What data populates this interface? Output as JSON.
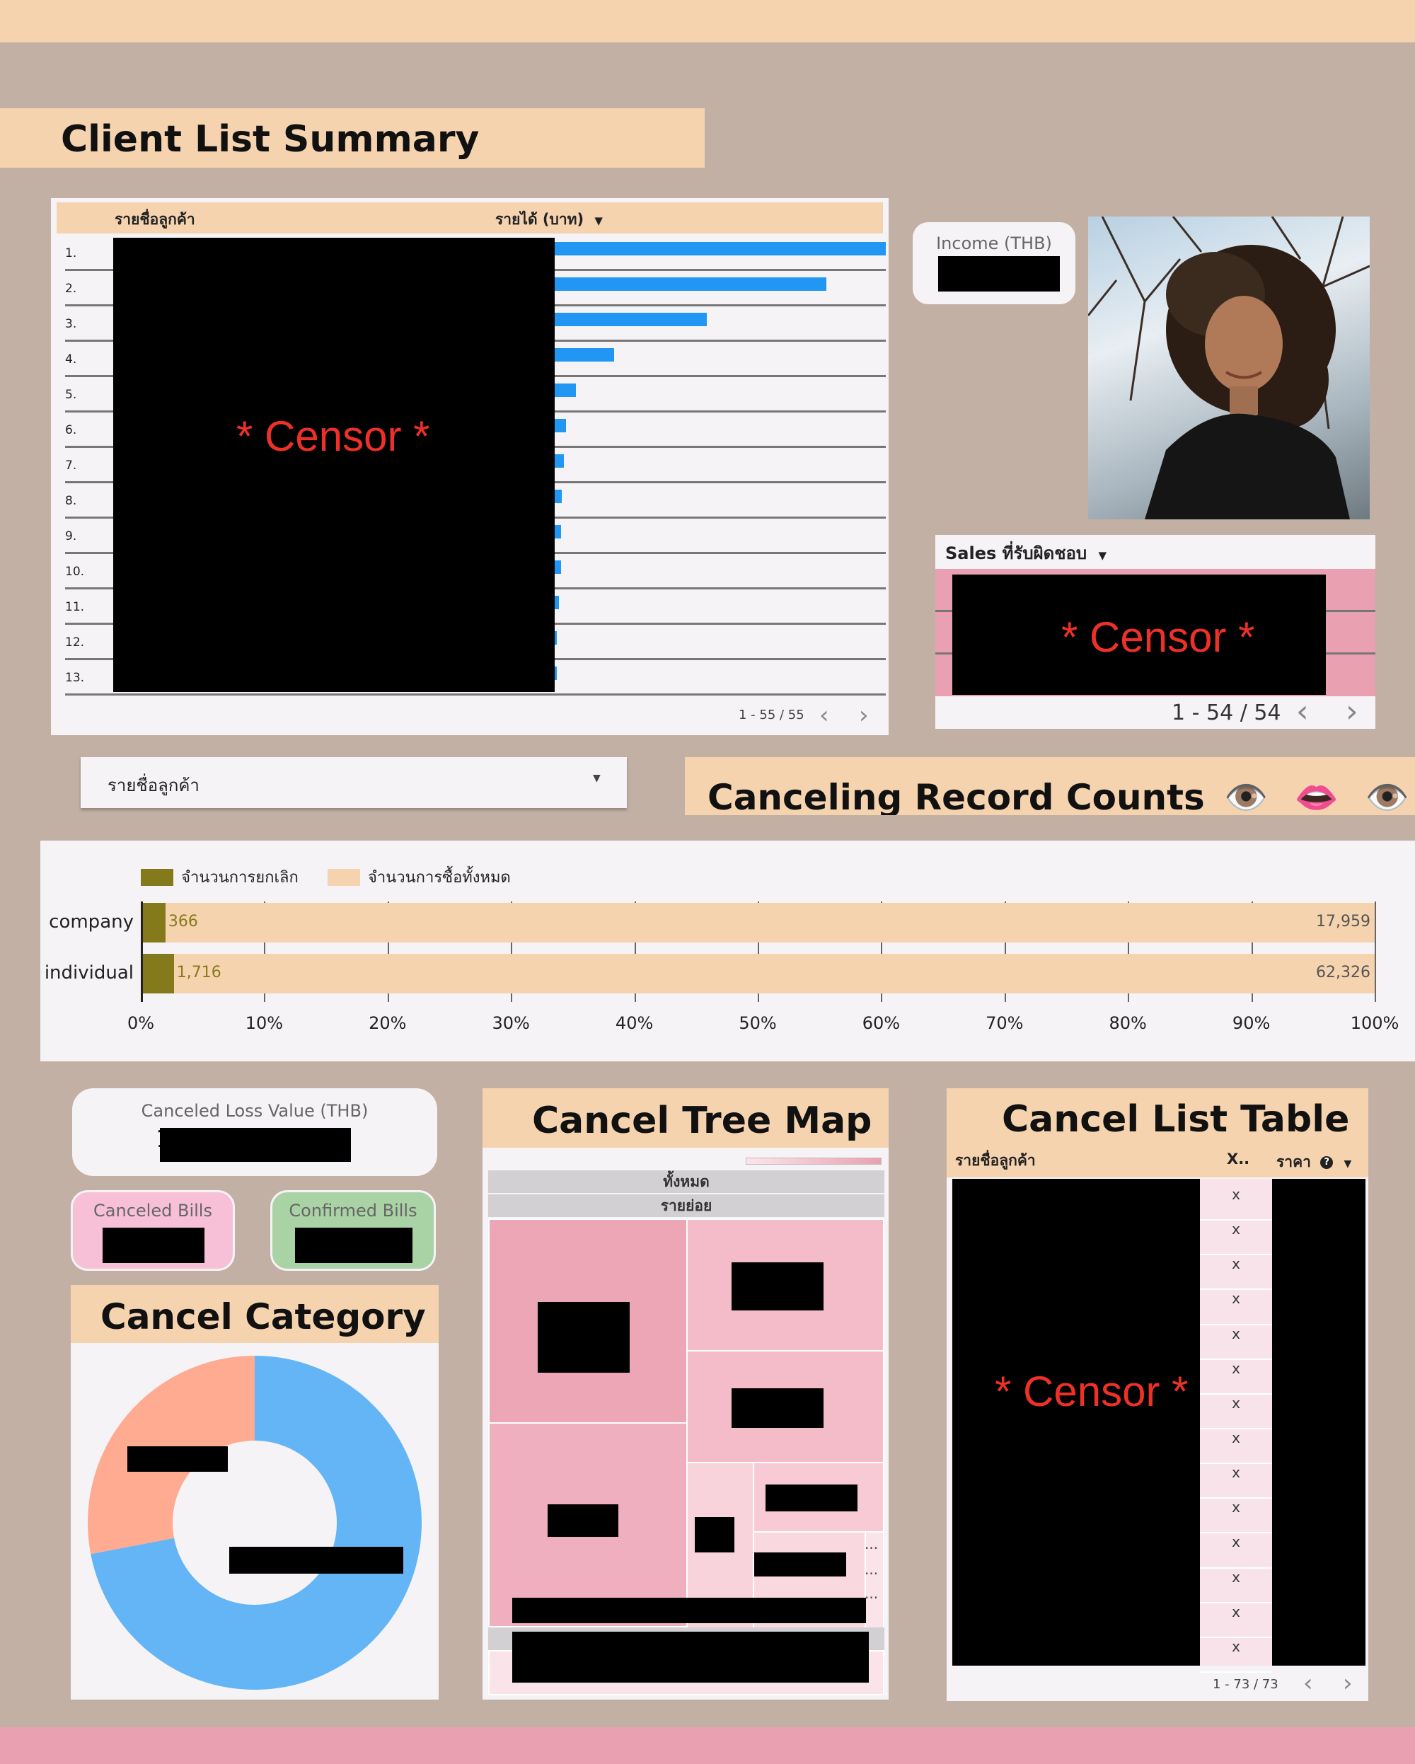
{
  "client_list": {
    "title": "Client List Summary",
    "col_client": "รายชื่อลูกค้า",
    "col_income": "รายได้ (บาท)",
    "sort_icon": "triangle-down-icon",
    "rows": [
      {
        "rank": "1.",
        "value": 1.0
      },
      {
        "rank": "2.",
        "value": 0.82
      },
      {
        "rank": "3.",
        "value": 0.46
      },
      {
        "rank": "4.",
        "value": 0.18
      },
      {
        "rank": "5.",
        "value": 0.065
      },
      {
        "rank": "6.",
        "value": 0.035
      },
      {
        "rank": "7.",
        "value": 0.028
      },
      {
        "rank": "8.",
        "value": 0.022
      },
      {
        "rank": "9.",
        "value": 0.02
      },
      {
        "rank": "10.",
        "value": 0.02
      },
      {
        "rank": "11.",
        "value": 0.012
      },
      {
        "rank": "12.",
        "value": 0.006
      },
      {
        "rank": "13.",
        "value": 0.006
      }
    ],
    "censor": "* Censor *",
    "pager": "1 - 55 / 55"
  },
  "income": {
    "label": "Income (THB)"
  },
  "sales": {
    "header": "Sales ที่รับผิดชอบ",
    "censor": "* Censor *",
    "pager": "1 - 54 / 54"
  },
  "filter": {
    "label": "รายชื่อลูกค้า"
  },
  "canceling": {
    "title": "Canceling Record Counts",
    "emojis": [
      "👁️",
      "👄",
      "👁️",
      "💧"
    ]
  },
  "chart_data": {
    "type": "bar",
    "stacked": "100%",
    "orientation": "horizontal",
    "categories": [
      "company",
      "individual"
    ],
    "series": [
      {
        "name": "จำนวนการยกเลิก",
        "values": [
          366,
          1716
        ],
        "labels": [
          "366",
          "1,716"
        ],
        "color": "#857a1b"
      },
      {
        "name": "จำนวนการซื้อทั้งหมด",
        "values": [
          17959,
          62326
        ],
        "labels": [
          "17,959",
          "62,326"
        ],
        "color": "#f6d3af"
      }
    ],
    "xticks": [
      "0%",
      "10%",
      "20%",
      "30%",
      "40%",
      "50%",
      "60%",
      "70%",
      "80%",
      "90%",
      "100%"
    ],
    "legend_position": "top-left",
    "grid": true
  },
  "canceled_loss": {
    "label": "Canceled Loss Value (THB)",
    "prefix": "1"
  },
  "canceled_bills": {
    "label": "Canceled Bills",
    "color": "#f7c0d6"
  },
  "confirmed_bills": {
    "label": "Confirmed Bills",
    "color": "#a9d2a5"
  },
  "cancel_category": {
    "title": "Cancel Category",
    "slices": [
      {
        "value": 0.72,
        "color": "#64b5f6"
      },
      {
        "value": 0.28,
        "color": "#ffab91"
      }
    ]
  },
  "tree_map": {
    "title": "Cancel Tree Map",
    "level1": "ทั้งหมด",
    "level2": "รายย่อย",
    "ellipsis": "..."
  },
  "cancel_list": {
    "title": "Cancel List Table",
    "col_client": "รายชื่อลูกค้า",
    "col_x": "X..",
    "col_price": "ราคา",
    "help_icon": "question-circle-icon",
    "x_value": "x",
    "x_count": 14,
    "censor": "* Censor *",
    "pager": "1 - 73 / 73"
  },
  "colors": {
    "background": "#c2b0a4",
    "header_peach": "#f6d3af",
    "bar_blue": "#2196f3",
    "sales_pink": "#e9a1b1",
    "footer_pink": "#e9a1b1"
  }
}
